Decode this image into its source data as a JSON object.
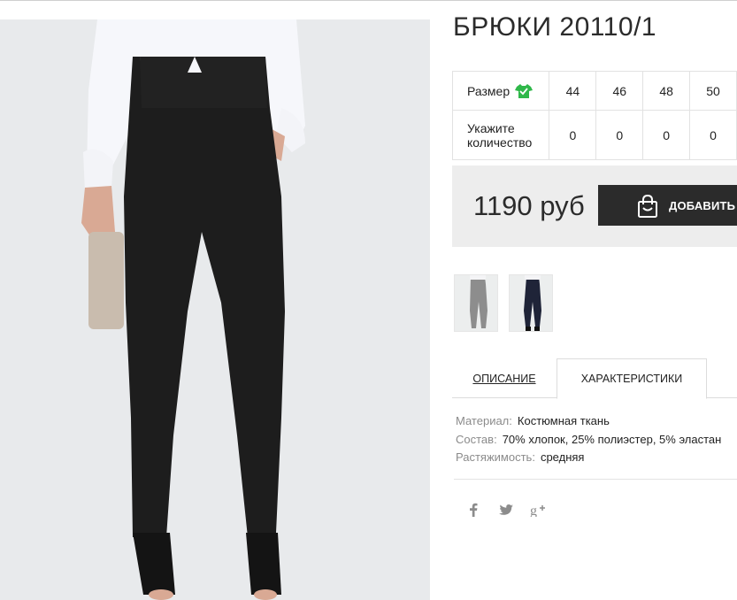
{
  "product": {
    "title": "БРЮКИ 20110/1",
    "price": "1190 руб",
    "add_to_cart_label": "ДОБАВИТЬ В"
  },
  "size_table": {
    "size_label": "Размер",
    "qty_label": "Укажите количество",
    "sizes": [
      "44",
      "46",
      "48",
      "50"
    ],
    "quantities": [
      "0",
      "0",
      "0",
      "0"
    ]
  },
  "tabs": {
    "description": "ОПИСАНИЕ",
    "characteristics": "ХАРАКТЕРИСТИКИ",
    "active": "characteristics"
  },
  "specs": [
    {
      "key": "Материал:",
      "value": "Костюмная ткань"
    },
    {
      "key": "Состав:",
      "value": "70% хлопок, 25% полиэстер, 5% эластан"
    },
    {
      "key": "Растяжимость:",
      "value": "средняя"
    }
  ],
  "social": [
    "facebook-icon",
    "twitter-icon",
    "google-plus-icon"
  ],
  "colors": {
    "accent_green": "#2fb84a",
    "button_dark": "#2b2b2b",
    "buy_box_bg": "#ededed"
  }
}
